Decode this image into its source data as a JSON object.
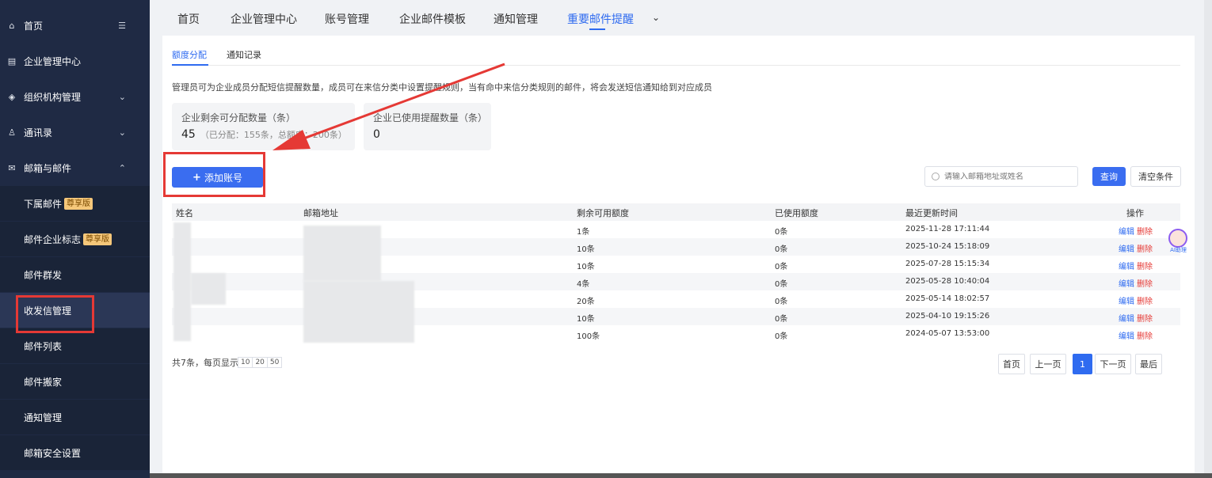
{
  "sidebar": {
    "items": [
      {
        "label": "首页",
        "icon": "home-icon",
        "right": "☰"
      },
      {
        "label": "企业管理中心",
        "icon": "building-icon"
      },
      {
        "label": "组织机构管理",
        "icon": "org-icon",
        "right": "⌄"
      },
      {
        "label": "通讯录",
        "icon": "contacts-icon",
        "right": "⌄"
      },
      {
        "label": "邮箱与邮件",
        "icon": "mail-icon",
        "right": "⌃"
      }
    ],
    "subitems": [
      {
        "label": "下属邮件",
        "badge": "尊享版"
      },
      {
        "label": "邮件企业标志",
        "badge": "尊享版"
      },
      {
        "label": "邮件群发"
      },
      {
        "label": "收发信管理"
      },
      {
        "label": "邮件列表"
      },
      {
        "label": "邮件搬家"
      },
      {
        "label": "通知管理"
      },
      {
        "label": "邮箱安全设置"
      }
    ]
  },
  "topnav": {
    "tabs": [
      "首页",
      "企业管理中心",
      "账号管理",
      "企业邮件模板",
      "通知管理",
      "重要邮件提醒"
    ],
    "active_index": 5,
    "more_icon": "chevron-down-icon"
  },
  "subtabs": [
    "额度分配",
    "通知记录"
  ],
  "description": "管理员可为企业成员分配短信提醒数量，成员可在来信分类中设置提醒规则，当有命中来信分类规则的邮件，将会发送短信通知给到对应成员",
  "cards": [
    {
      "label": "企业剩余可分配数量（条）",
      "value": "45",
      "note": "（已分配：155条，总额度：200条）"
    },
    {
      "label": "企业已使用提醒数量（条）",
      "value": "0"
    }
  ],
  "add_button": "添加账号",
  "search": {
    "placeholder": "请输入邮箱地址或姓名",
    "value": ""
  },
  "query_button": "查询",
  "clear_button": "清空条件",
  "table": {
    "headers": [
      "姓名",
      "邮箱地址",
      "剩余可用额度",
      "已使用额度",
      "最近更新时间",
      "操作"
    ],
    "rows": [
      {
        "remaining": "1条",
        "used": "0条",
        "updated": "2025-11-28 17:11:44"
      },
      {
        "remaining": "10条",
        "used": "0条",
        "updated": "2025-10-24 15:18:09"
      },
      {
        "remaining": "10条",
        "used": "0条",
        "updated": "2025-07-28 15:15:34"
      },
      {
        "remaining": "4条",
        "used": "0条",
        "updated": "2025-05-28 10:40:04"
      },
      {
        "remaining": "20条",
        "used": "0条",
        "updated": "2025-05-14 18:02:57"
      },
      {
        "remaining": "10条",
        "used": "0条",
        "updated": "2025-04-10 19:15:26"
      },
      {
        "remaining": "100条",
        "used": "0条",
        "updated": "2024-05-07 13:53:00"
      }
    ],
    "edit_label": "编辑",
    "delete_label": "删除"
  },
  "pagination": {
    "total_text": "共7条，每页显示",
    "sizes": [
      "10",
      "20",
      "50"
    ],
    "first": "首页",
    "prev": "上一页",
    "current": "1",
    "next": "下一页",
    "last": "最后"
  },
  "assistant": {
    "label": "AI助理"
  },
  "colors": {
    "accent": "#2f6bf0",
    "sidebar_bg": "#1f2a44",
    "annotation": "#e53935"
  }
}
